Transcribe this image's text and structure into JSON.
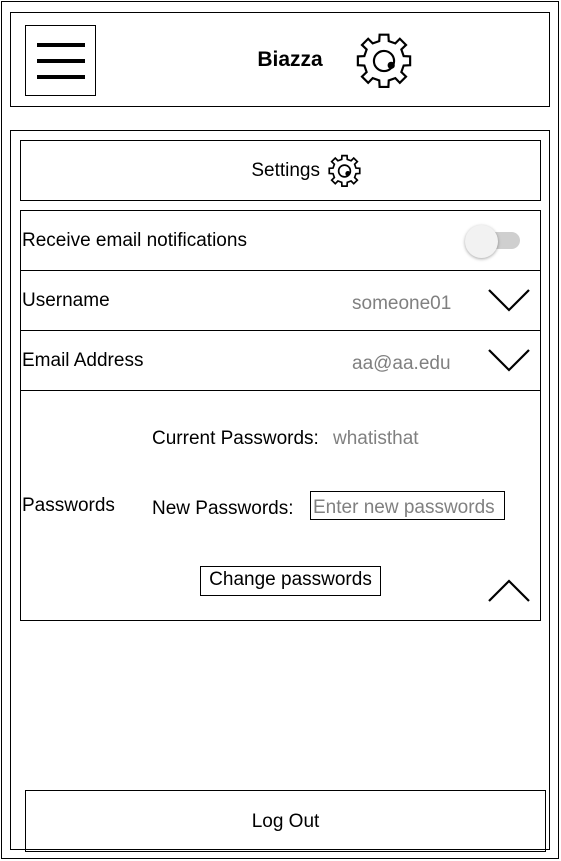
{
  "header": {
    "title": "Biazza",
    "menu_icon": "hamburger-menu-icon",
    "settings_icon": "gear-icon"
  },
  "settings": {
    "title": "Settings",
    "icon": "gear-icon"
  },
  "email_notifications": {
    "label": "Receive email notifications",
    "enabled": false
  },
  "username": {
    "label": "Username",
    "value": "someone01"
  },
  "email": {
    "label": "Email Address",
    "value": "aa@aa.edu"
  },
  "passwords": {
    "label": "Passwords",
    "current_label": "Current Passwords:",
    "current_value": "whatisthat",
    "new_label": "New Passwords:",
    "new_placeholder": "Enter new passwords",
    "change_button": "Change passwords"
  },
  "logout": {
    "label": "Log Out"
  }
}
